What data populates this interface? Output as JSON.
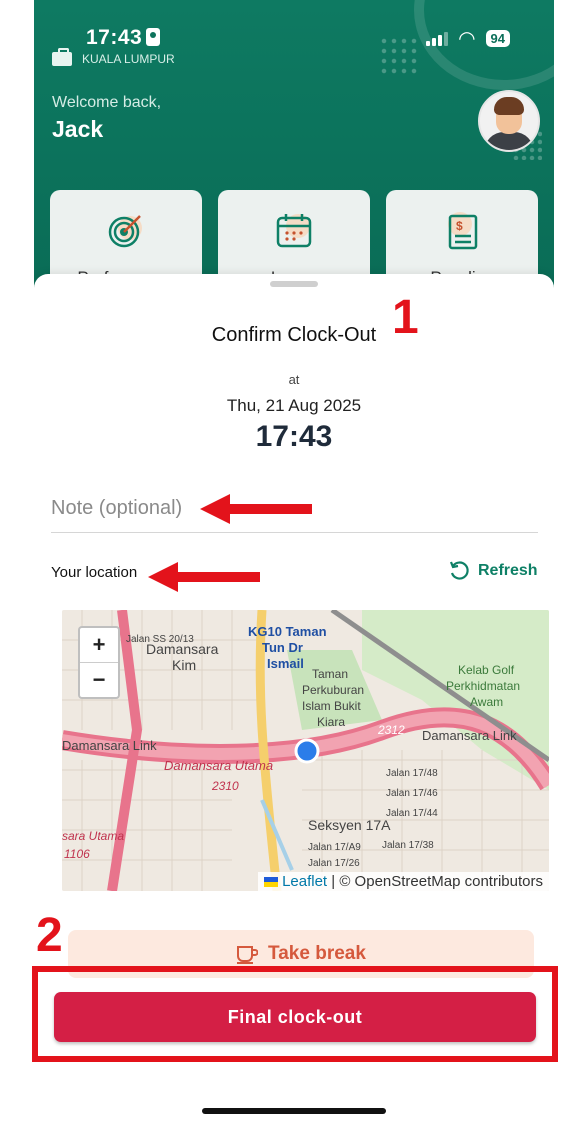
{
  "status_bar": {
    "time": "17:43",
    "battery": "94"
  },
  "header": {
    "city": "KUALA LUMPUR",
    "welcome": "Welcome back,",
    "user_name": "Jack",
    "tiles": [
      {
        "label": "Performance",
        "icon": "target-icon"
      },
      {
        "label": "Leave",
        "icon": "calendar-icon"
      },
      {
        "label": "Payslips",
        "icon": "payslip-icon"
      }
    ]
  },
  "sheet": {
    "title": "Confirm Clock-Out",
    "at": "at",
    "date": "Thu, 21 Aug 2025",
    "time": "17:43",
    "note_placeholder": "Note (optional)",
    "location_label": "Your location",
    "refresh_label": "Refresh",
    "take_break_label": "Take break",
    "final_clock_out_label": "Final clock-out"
  },
  "map": {
    "zoom_in": "+",
    "zoom_out": "−",
    "attribution_leaflet": "Leaflet",
    "attribution_rest": " | © OpenStreetMap contributors",
    "labels": [
      "KG10 Taman",
      "Tun Dr",
      "Ismail",
      "Damansara",
      "Kim",
      "Taman",
      "Perkuburan",
      "Islam Bukit",
      "Kiara",
      "Kelab Golf",
      "Perkhidmatan",
      "Awam",
      "Damansara Link",
      "Damansara Utama",
      "2310",
      "2312",
      "Seksyen 17A",
      "sara Utama",
      "1106",
      "Jalan SS 20/13",
      "Jalan 17/48",
      "Jalan 17/46",
      "Jalan 17/44",
      "Jalan 17/38",
      "Jalan 17/A9",
      "Jalan 17/26"
    ]
  },
  "annotations": {
    "num1": "1",
    "num2": "2"
  },
  "colors": {
    "brand": "#0b6e58",
    "danger": "#d41f45",
    "annotation": "#e3131b"
  }
}
